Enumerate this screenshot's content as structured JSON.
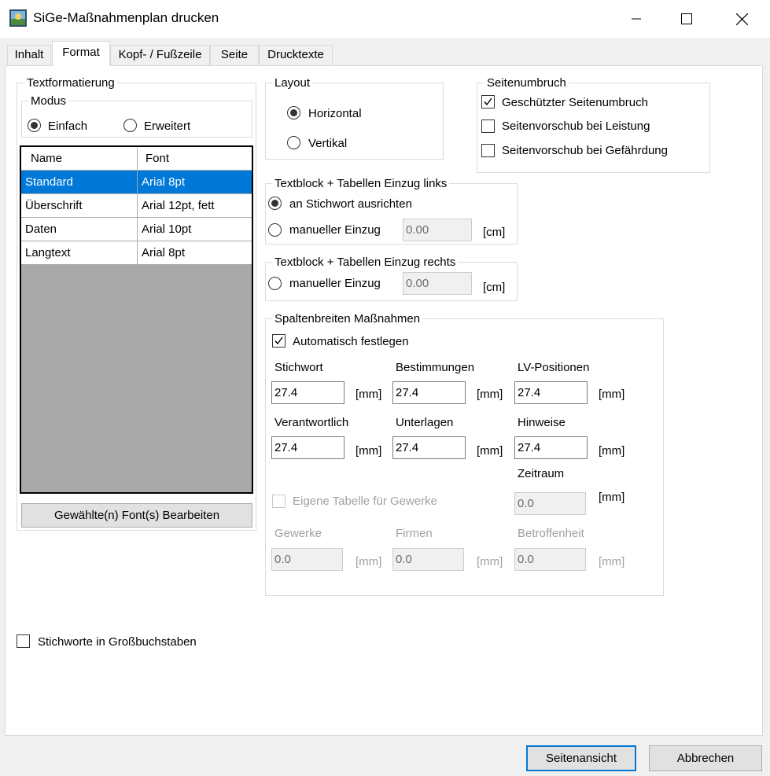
{
  "window": {
    "title": "SiGe-Maßnahmenplan drucken",
    "app_icon": "sige-app-icon",
    "controls": [
      "minimize-icon",
      "maximize-icon",
      "close-icon"
    ]
  },
  "tabs": [
    {
      "label": "Inhalt",
      "active": false
    },
    {
      "label": "Format",
      "active": true
    },
    {
      "label": "Kopf- / Fußzeile",
      "active": false
    },
    {
      "label": "Seite",
      "active": false
    },
    {
      "label": "Drucktexte",
      "active": false
    }
  ],
  "textformat": {
    "title": "Textformatierung",
    "modus": {
      "title": "Modus",
      "einfach": "Einfach",
      "erweitert": "Erweitert",
      "selected": "Einfach"
    },
    "table": {
      "headers": [
        "Name",
        "Font"
      ],
      "rows": [
        {
          "name": "Standard",
          "font": "Arial 8pt",
          "selected": true
        },
        {
          "name": "Überschrift",
          "font": "Arial 12pt, fett",
          "selected": false
        },
        {
          "name": "Daten",
          "font": "Arial 10pt",
          "selected": false
        },
        {
          "name": "Langtext",
          "font": "Arial 8pt",
          "selected": false
        }
      ]
    },
    "edit_button": "Gewählte(n) Font(s) Bearbeiten"
  },
  "layout": {
    "title": "Layout",
    "horizontal": "Horizontal",
    "vertikal": "Vertikal",
    "selected": "Horizontal"
  },
  "seitenumbruch": {
    "title": "Seitenumbruch",
    "items": [
      {
        "label": "Geschützter Seitenumbruch",
        "checked": true
      },
      {
        "label": "Seitenvorschub bei Leistung",
        "checked": false
      },
      {
        "label": "Seitenvorschub bei Gefährdung",
        "checked": false
      }
    ]
  },
  "einzug_links": {
    "title": "Textblock + Tabellen Einzug links",
    "option1": "an Stichwort ausrichten",
    "option2": "manueller Einzug",
    "selected": "an Stichwort ausrichten",
    "value": "0.00",
    "unit": "[cm]"
  },
  "einzug_rechts": {
    "title": "Textblock + Tabellen Einzug rechts",
    "option1": "manueller Einzug",
    "value": "0.00",
    "unit": "[cm]"
  },
  "spaltenbreiten": {
    "title": "Spaltenbreiten Maßnahmen",
    "auto_label": "Automatisch festlegen",
    "auto_checked": true,
    "unit": "[mm]",
    "fields": [
      {
        "label": "Stichwort",
        "value": "27.4"
      },
      {
        "label": "Bestimmungen",
        "value": "27.4"
      },
      {
        "label": "LV-Positionen",
        "value": "27.4"
      },
      {
        "label": "Verantwortlich",
        "value": "27.4"
      },
      {
        "label": "Unterlagen",
        "value": "27.4"
      },
      {
        "label": "Hinweise",
        "value": "27.4"
      }
    ],
    "zeitraum": {
      "label": "Zeitraum",
      "value": "0.0"
    },
    "eigene_tabelle": {
      "label": "Eigene Tabelle für Gewerke",
      "checked": false
    },
    "gewerke_fields": [
      {
        "label": "Gewerke",
        "value": "0.0"
      },
      {
        "label": "Firmen",
        "value": "0.0"
      },
      {
        "label": "Betroffenheit",
        "value": "0.0"
      }
    ]
  },
  "grossbuchstaben": {
    "label": "Stichworte in Großbuchstaben",
    "checked": false
  },
  "footer": {
    "preview_button": "Seitenansicht",
    "cancel_button": "Abbrechen"
  }
}
